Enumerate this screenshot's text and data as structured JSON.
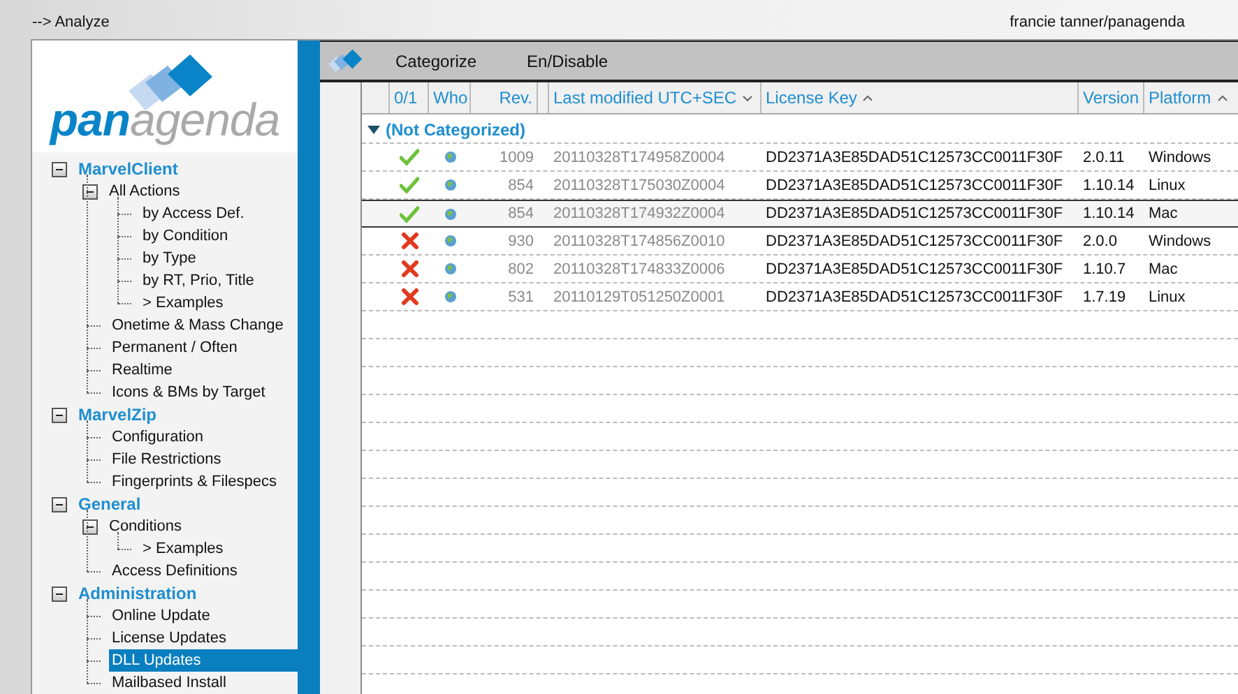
{
  "header": {
    "breadcrumb": "--> Analyze",
    "user": "francie tanner/panagenda"
  },
  "logo": {
    "text": "**pan**agenda"
  },
  "sidebar": {
    "tree": [
      {
        "label": "MarvelClient",
        "expanded": true,
        "selected": false,
        "children": [
          {
            "label": "All Actions",
            "expanded": true,
            "selected": false,
            "children": [
              {
                "label": "by Access Def.",
                "selected": false
              },
              {
                "label": "by Condition",
                "selected": false
              },
              {
                "label": "by Type",
                "selected": false
              },
              {
                "label": "by RT, Prio, Title",
                "selected": false
              },
              {
                "label": "> Examples",
                "selected": false
              }
            ]
          },
          {
            "label": "Onetime & Mass Change",
            "selected": false
          },
          {
            "label": "Permanent / Often",
            "selected": false
          },
          {
            "label": "Realtime",
            "selected": false
          },
          {
            "label": "Icons & BMs by Target",
            "selected": false
          }
        ]
      },
      {
        "label": "MarvelZip",
        "expanded": true,
        "selected": false,
        "children": [
          {
            "label": "Configuration",
            "selected": false
          },
          {
            "label": "File Restrictions",
            "selected": false
          },
          {
            "label": "Fingerprints & Filespecs",
            "selected": false
          }
        ]
      },
      {
        "label": "General",
        "expanded": true,
        "selected": false,
        "children": [
          {
            "label": "Conditions",
            "expanded": true,
            "selected": false,
            "children": [
              {
                "label": "> Examples",
                "selected": false
              }
            ]
          },
          {
            "label": "Access Definitions",
            "selected": false
          }
        ]
      },
      {
        "label": "Administration",
        "expanded": true,
        "selected": false,
        "children": [
          {
            "label": "Online Update",
            "selected": false
          },
          {
            "label": "License Updates",
            "selected": false
          },
          {
            "label": "DLL Updates",
            "selected": true
          },
          {
            "label": "Mailbased Install",
            "selected": false
          }
        ]
      }
    ]
  },
  "toolbar": {
    "buttons": [
      "Categorize",
      "En/Disable"
    ]
  },
  "table": {
    "columns": [
      {
        "label": "0/1"
      },
      {
        "label": "Who"
      },
      {
        "label": "Rev."
      },
      {
        "label": "Last modified UTC+SEC",
        "sort_ascending": false
      },
      {
        "label": "License Key",
        "sort_ascending": true
      },
      {
        "label": "Version"
      },
      {
        "label": "Platform",
        "sort_ascending": true
      }
    ],
    "category": {
      "label": "(Not Categorized)",
      "expanded": true
    },
    "rows": [
      {
        "enabled": true,
        "rev": "1009",
        "modified": "20110328T174958Z0004",
        "license_key": "DD2371A3E85DAD51C12573CC0011F30F",
        "version": "2.0.11",
        "platform": "Windows",
        "selected": false
      },
      {
        "enabled": true,
        "rev": "854",
        "modified": "20110328T175030Z0004",
        "license_key": "DD2371A3E85DAD51C12573CC0011F30F",
        "version": "1.10.14",
        "platform": "Linux",
        "selected": false
      },
      {
        "enabled": true,
        "rev": "854",
        "modified": "20110328T174932Z0004",
        "license_key": "DD2371A3E85DAD51C12573CC0011F30F",
        "version": "1.10.14",
        "platform": "Mac",
        "selected": true
      },
      {
        "enabled": false,
        "rev": "930",
        "modified": "20110328T174856Z0010",
        "license_key": "DD2371A3E85DAD51C12573CC0011F30F",
        "version": "2.0.0",
        "platform": "Windows",
        "selected": false
      },
      {
        "enabled": false,
        "rev": "802",
        "modified": "20110328T174833Z0006",
        "license_key": "DD2371A3E85DAD51C12573CC0011F30F",
        "version": "1.10.7",
        "platform": "Mac",
        "selected": false
      },
      {
        "enabled": false,
        "rev": "531",
        "modified": "20110129T051250Z0001",
        "license_key": "DD2371A3E85DAD51C12573CC0011F30F",
        "version": "1.7.19",
        "platform": "Linux",
        "selected": false
      }
    ]
  }
}
